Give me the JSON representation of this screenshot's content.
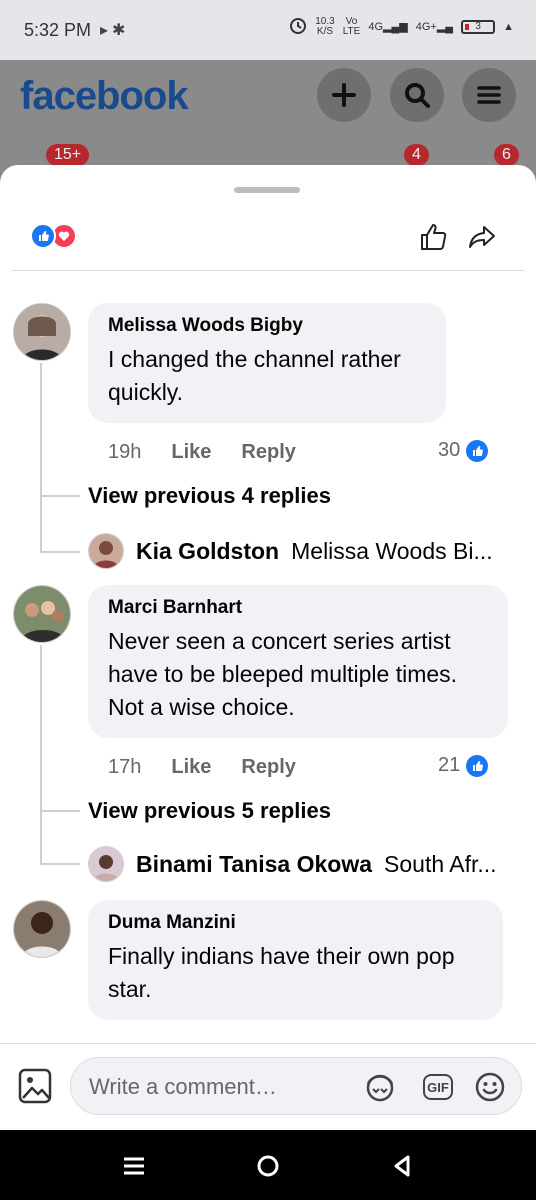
{
  "status_bar": {
    "time": "5:32 PM",
    "net_speed_value": "10.3",
    "net_speed_unit": "K/S",
    "volte_top": "Vo",
    "volte_bottom": "LTE",
    "lte_label": "4G",
    "fourg_label": "4G+",
    "battery_level": "3"
  },
  "header": {
    "logo": "facebook",
    "nav_badges": {
      "home": "15+",
      "notifications": "4",
      "messages": "6"
    }
  },
  "sheet": {
    "comments": [
      {
        "author": "Melissa Woods Bigby",
        "text": "I changed the channel rather quickly.",
        "time": "19h",
        "like_label": "Like",
        "reply_label": "Reply",
        "like_count": "30",
        "view_previous": "View previous 4 replies",
        "reply_preview": {
          "name": "Kia Goldston",
          "text": "Melissa Woods Bi..."
        }
      },
      {
        "author": "Marci Barnhart",
        "text": "Never seen a concert series artist have to be bleeped multiple times. Not a wise choice.",
        "time": "17h",
        "like_label": "Like",
        "reply_label": "Reply",
        "like_count": "21",
        "view_previous": "View previous 5 replies",
        "reply_preview": {
          "name": "Binami Tanisa Okowa",
          "text": "South Afr..."
        }
      },
      {
        "author": "Duma Manzini",
        "text": "Finally indians have their own pop star."
      }
    ]
  },
  "composer": {
    "placeholder": "Write a comment…",
    "gif_label": "GIF"
  },
  "colors": {
    "fb_blue": "#1877f2",
    "love_red": "#f33e58",
    "bubble_bg": "#f0f2f5",
    "meta_gray": "#65676b"
  }
}
